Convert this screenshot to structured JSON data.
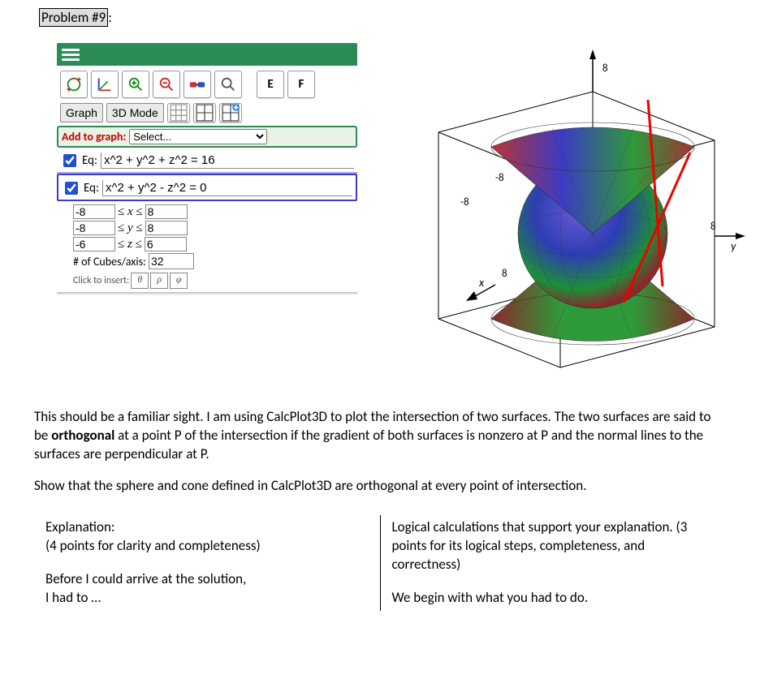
{
  "problem_label": "Problem #9",
  "problem_label_colon": ":",
  "toolbar": {
    "buttons": [
      "refresh",
      "axes",
      "zoom-in",
      "zoom-out",
      "glasses3d",
      "magnifier"
    ],
    "letter_buttons": [
      "E",
      "F"
    ]
  },
  "modebtns": {
    "graph": "Graph",
    "mode3d": "3D Mode"
  },
  "addrow": {
    "label": "Add to graph:",
    "select_placeholder": "Select..."
  },
  "eq1": {
    "checked": true,
    "label": "Eq:",
    "value": "x^2 + y^2 + z^2 = 16"
  },
  "eq2": {
    "checked": true,
    "label": "Eq:",
    "value": "x^2 + y^2 - z^2 = 0"
  },
  "ranges": {
    "x": {
      "lo": "-8",
      "hi": "8",
      "var": "x"
    },
    "y": {
      "lo": "-8",
      "hi": "8",
      "var": "y"
    },
    "z": {
      "lo": "-6",
      "hi": "6",
      "var": "z"
    }
  },
  "cubes": {
    "label": "# of Cubes/axis:",
    "value": "32"
  },
  "insert": {
    "label": "Click to insert:",
    "chars": [
      "θ",
      "ρ",
      "φ"
    ]
  },
  "axes3d": {
    "x": "x",
    "y": "y",
    "xtick": "8",
    "xtickneg": "-8",
    "ztick": "8",
    "yneg": "-8"
  },
  "body_p1_a": "This should be a familiar sight.  I am using CalcPlot3D to plot the intersection of two surfaces.  The two surfaces are said to be ",
  "body_p1_bold": "orthogonal",
  "body_p1_b": " at a point P of the intersection if the gradient of both surfaces is nonzero at P and the normal lines to the surfaces are perpendicular at P.",
  "body_p2": "Show that the sphere and cone defined in CalcPlot3D are orthogonal at every point of intersection.",
  "left_col": {
    "h": "Explanation:",
    "sub": "(4 points for clarity and completeness)",
    "line1": "Before I could arrive at the solution,",
    "line2": "I had to …"
  },
  "right_col": {
    "h": "Logical calculations that support your explanation. (3 points for its logical steps, completeness, and correctness)",
    "line1": "We begin with what you had to do."
  }
}
